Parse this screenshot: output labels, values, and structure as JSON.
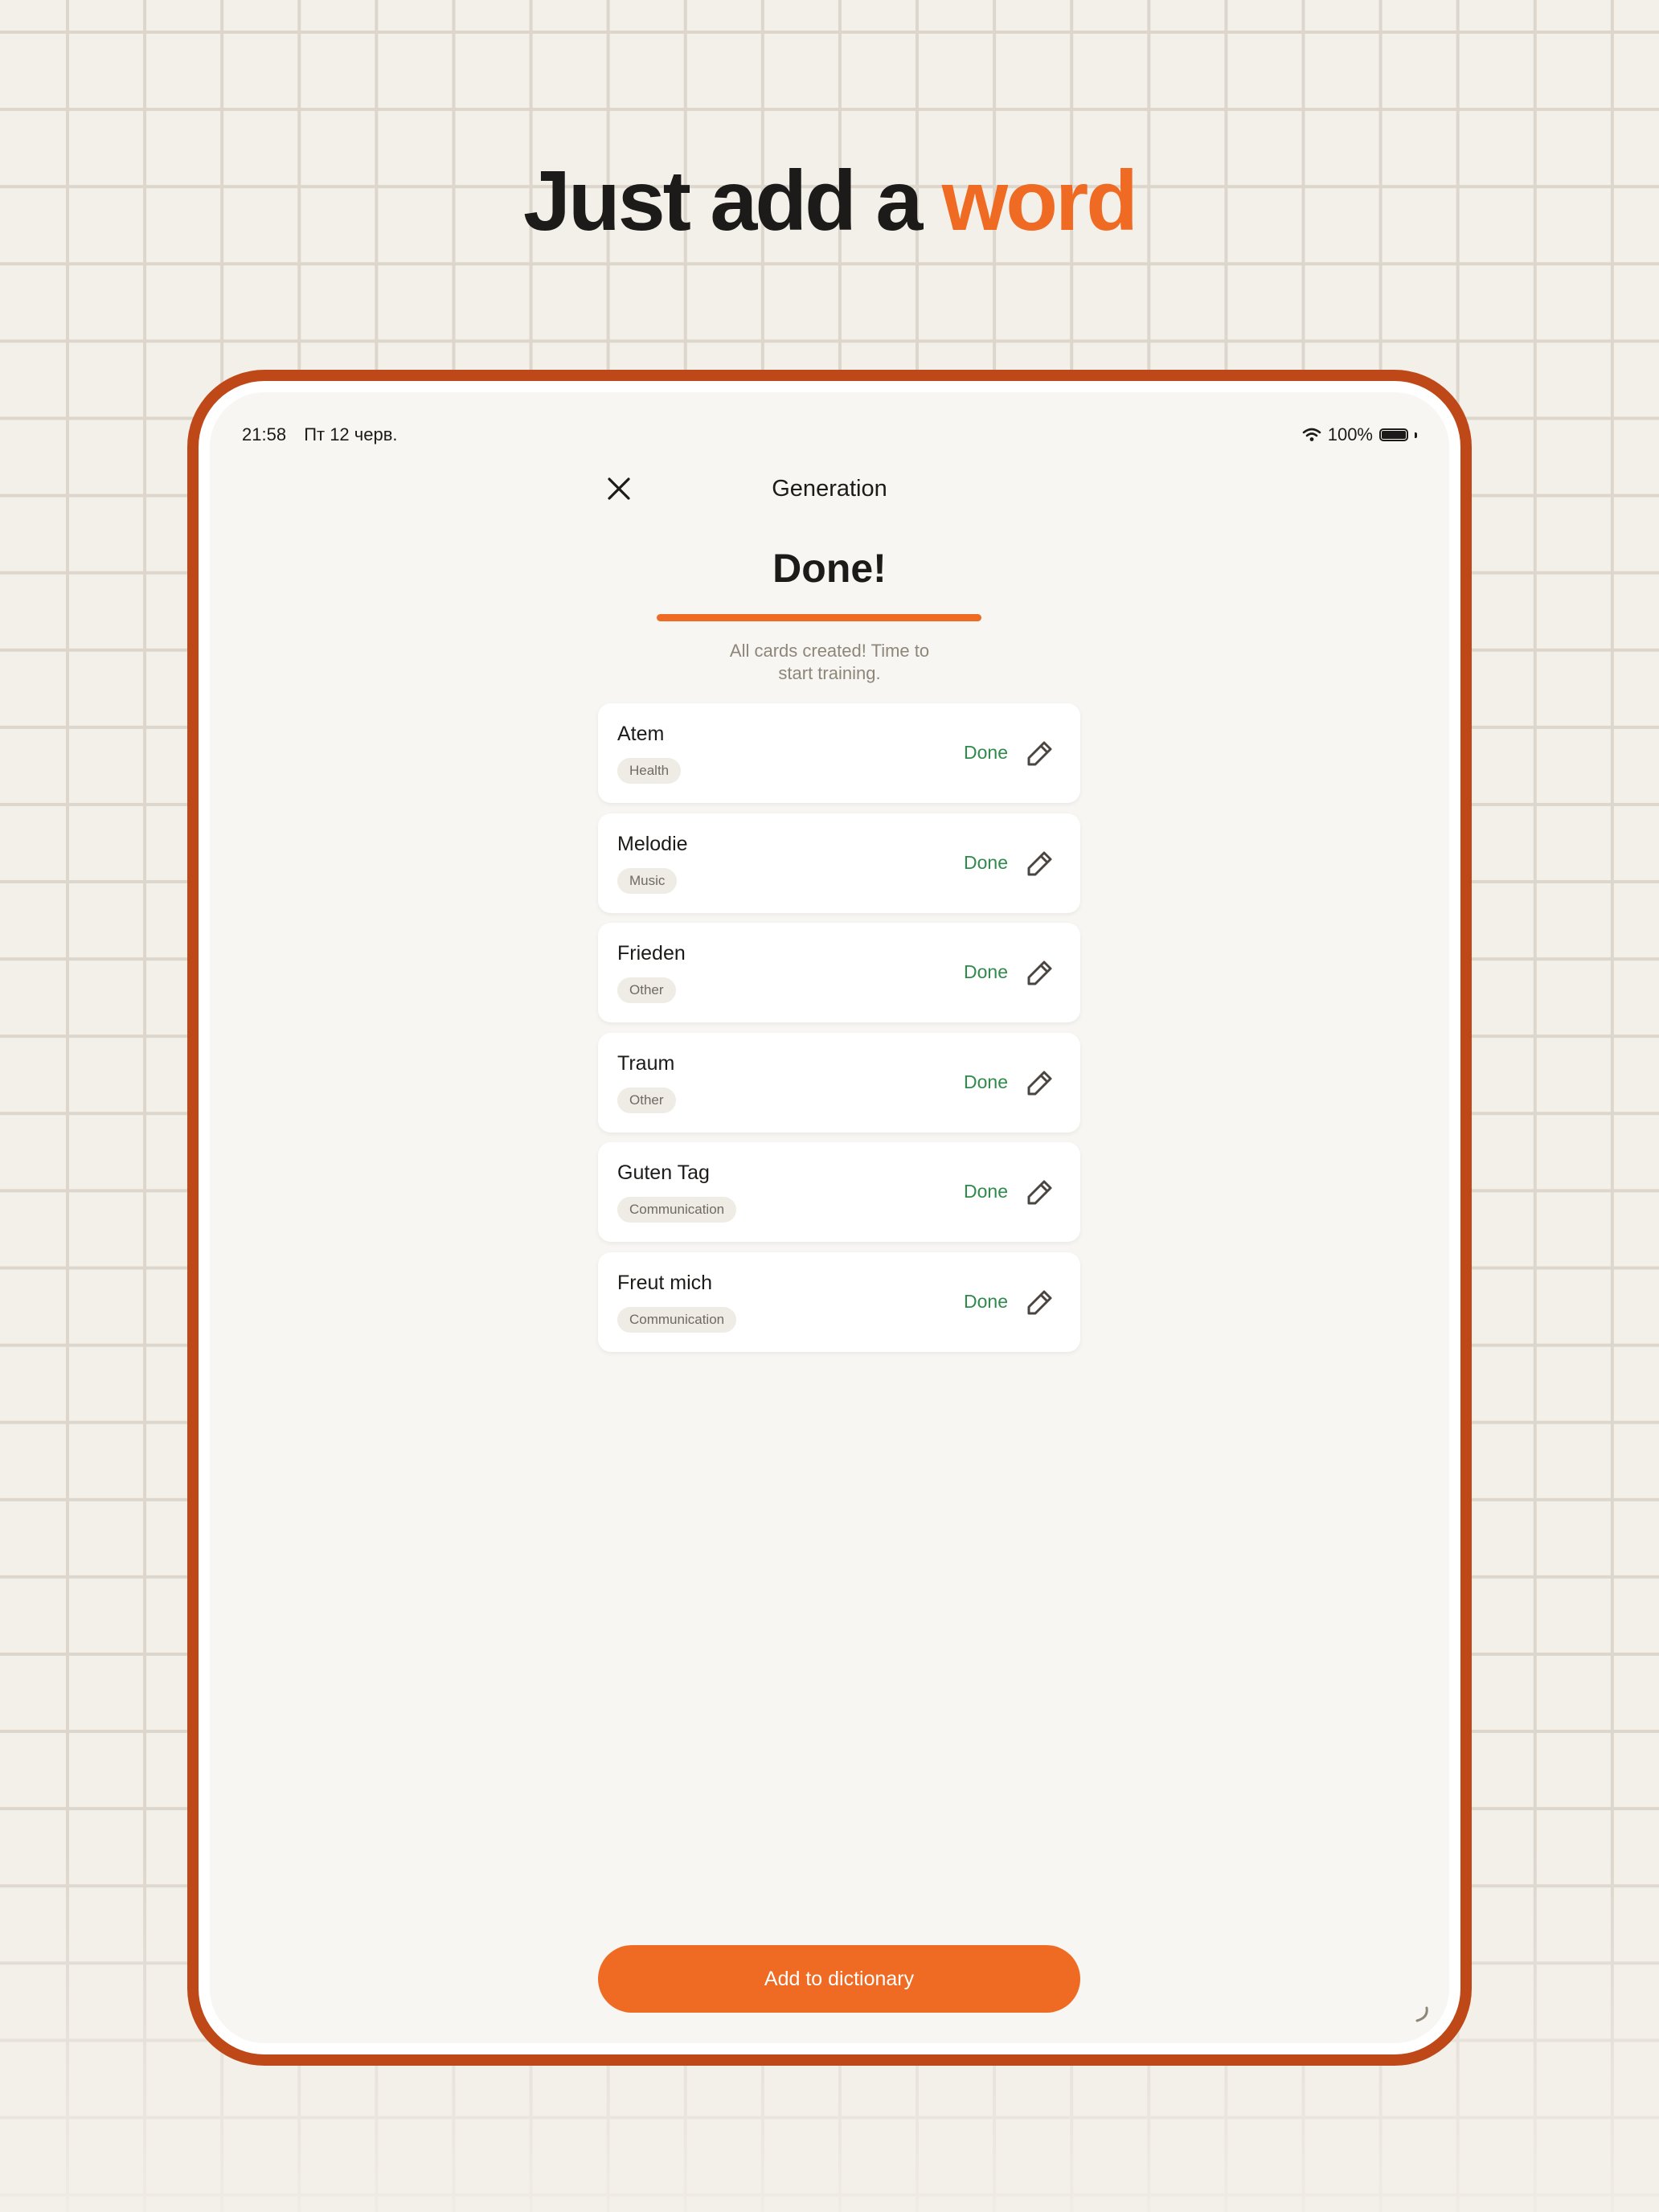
{
  "headline": {
    "prefix": "Just add a ",
    "accent": "word"
  },
  "colors": {
    "accent": "#ef6a22",
    "frame": "#bf4818",
    "done_green": "#2f8a4c"
  },
  "status_bar": {
    "time": "21:58",
    "date": "Пт 12 черв.",
    "battery": "100%",
    "icons": [
      "wifi-icon",
      "battery-icon"
    ]
  },
  "header": {
    "title": "Generation",
    "close_icon": "close-icon"
  },
  "result": {
    "title": "Done!",
    "progress": 1.0,
    "subtitle_line1": "All cards created! Time to",
    "subtitle_line2": "start training."
  },
  "cards": [
    {
      "word": "Atem",
      "tag": "Health",
      "status": "Done"
    },
    {
      "word": "Melodie",
      "tag": "Music",
      "status": "Done"
    },
    {
      "word": "Frieden",
      "tag": "Other",
      "status": "Done"
    },
    {
      "word": "Traum",
      "tag": "Other",
      "status": "Done"
    },
    {
      "word": "Guten Tag",
      "tag": "Communication",
      "status": "Done"
    },
    {
      "word": "Freut mich",
      "tag": "Communication",
      "status": "Done"
    }
  ],
  "actions": {
    "primary_label": "Add to dictionary"
  }
}
